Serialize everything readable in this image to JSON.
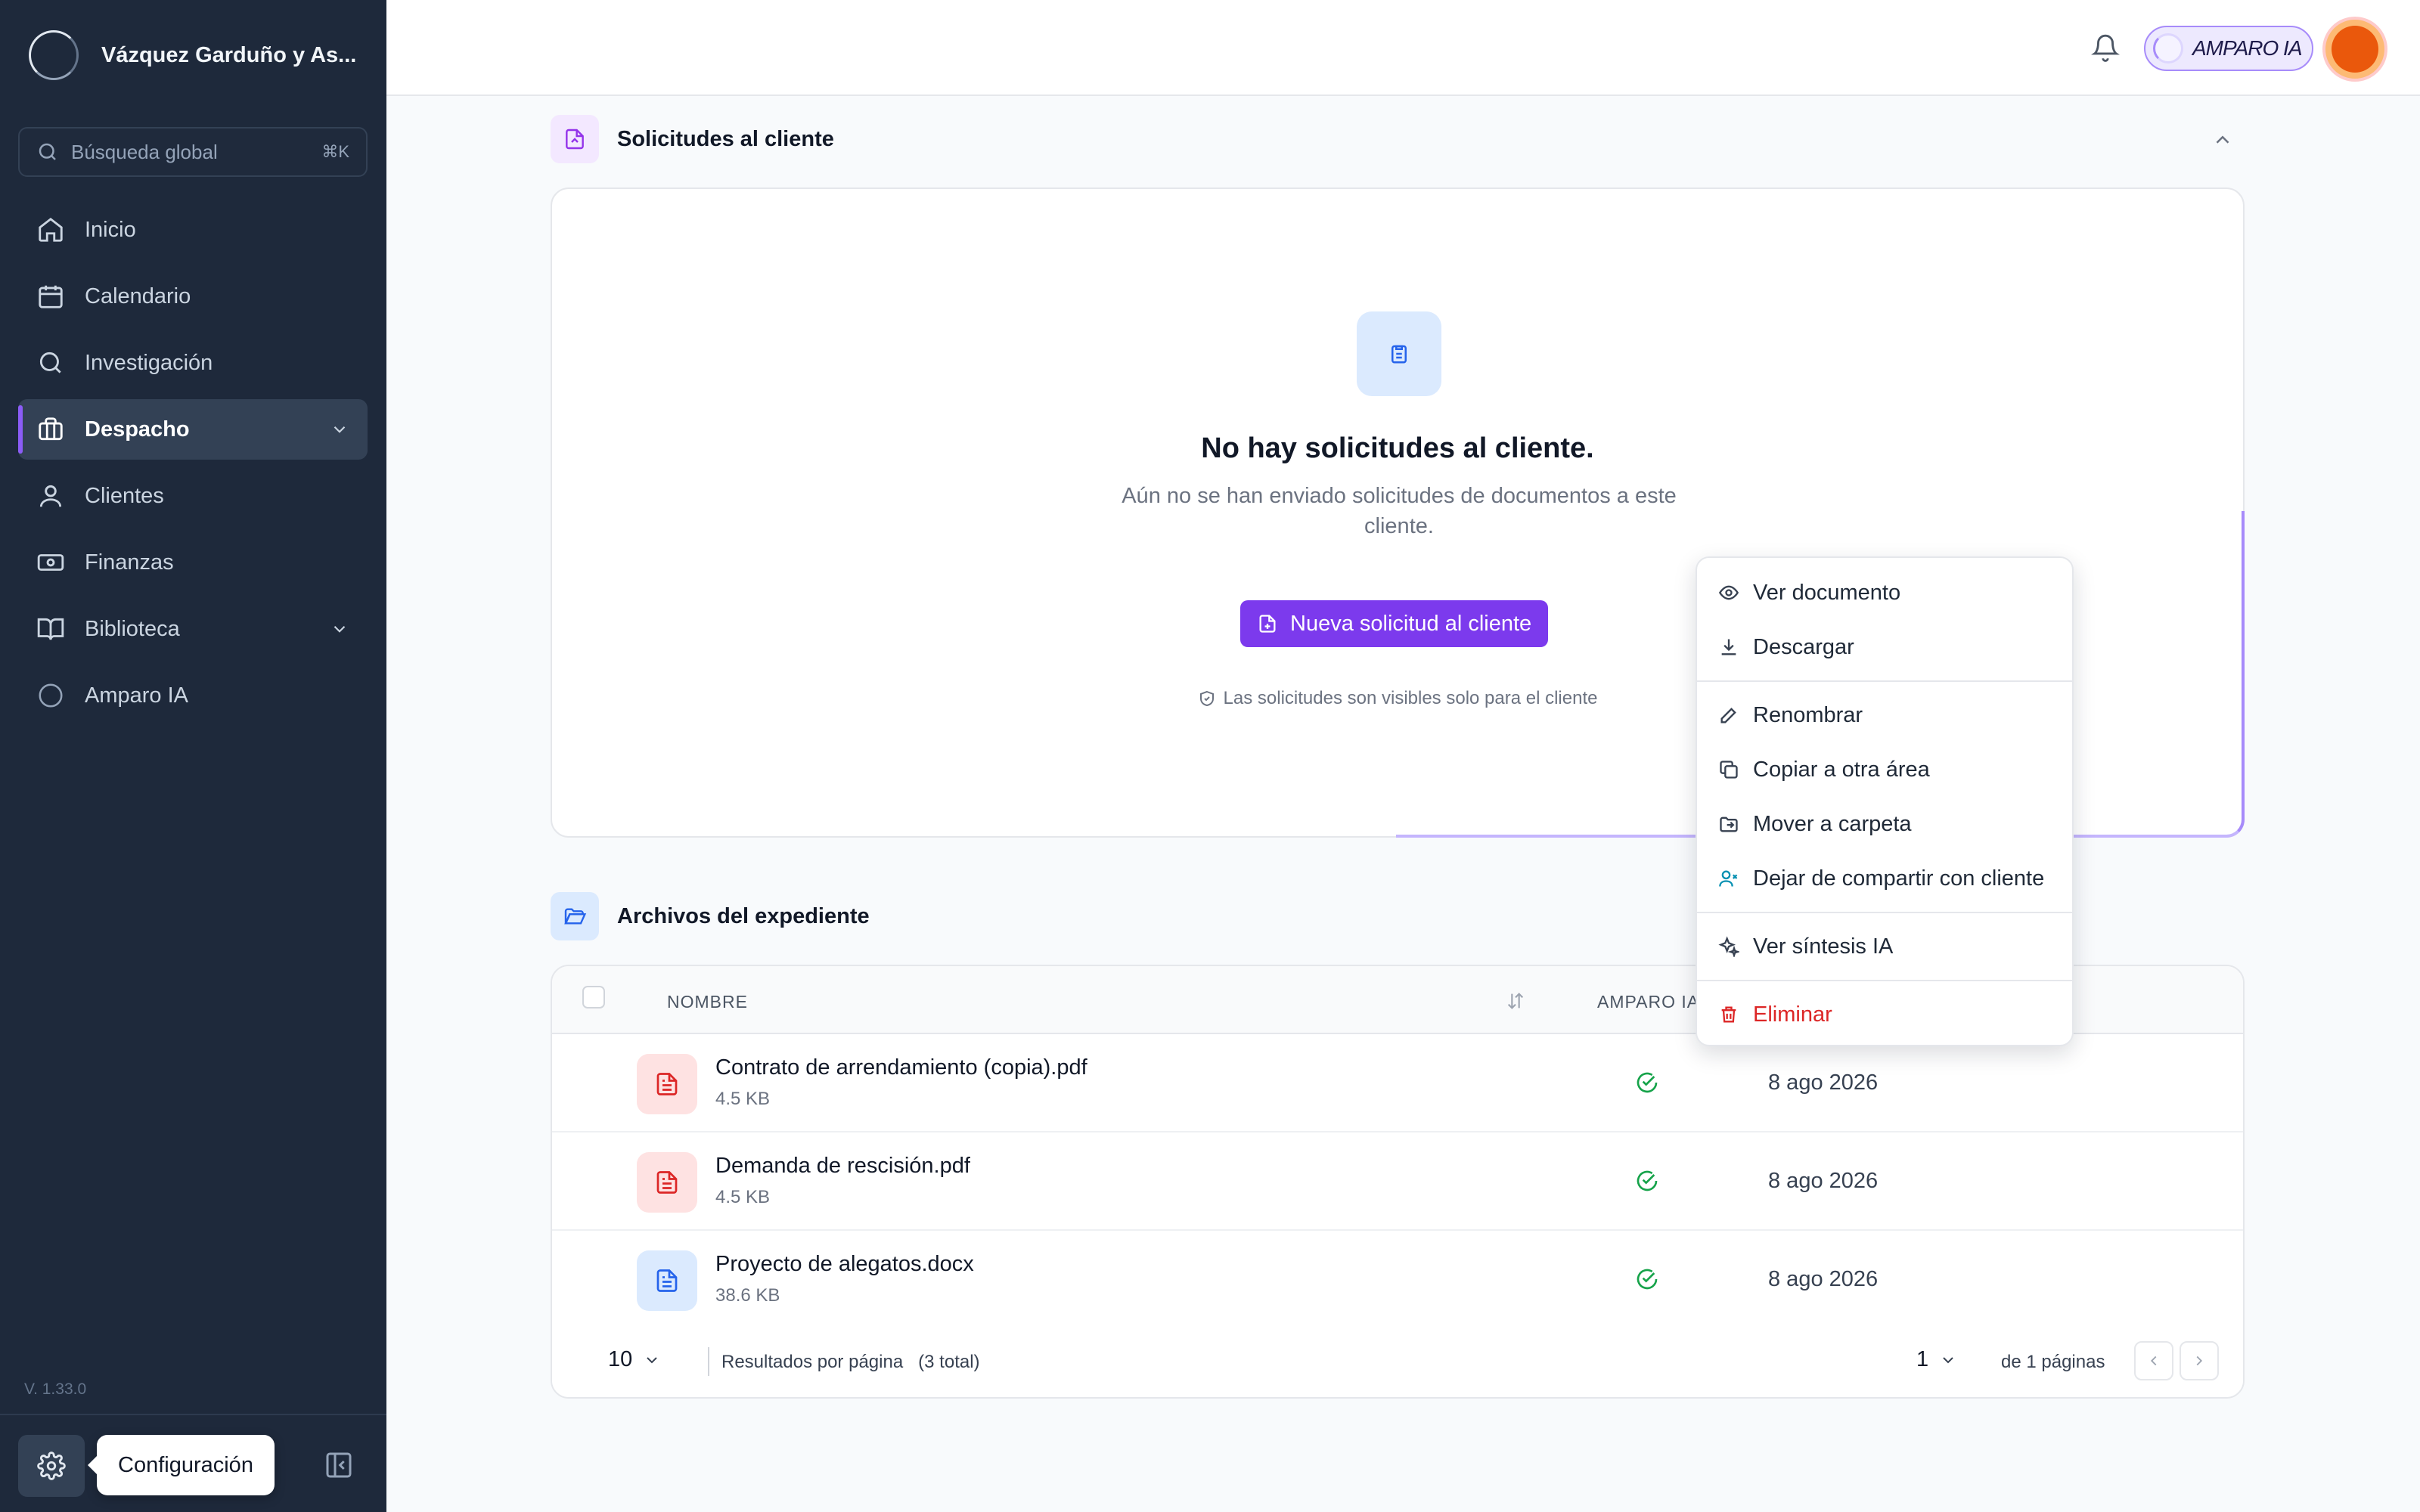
{
  "sidebar": {
    "brand": "Vázquez Garduño y As...",
    "search_placeholder": "Búsqueda global",
    "search_shortcut": "⌘K",
    "items": [
      {
        "label": "Inicio",
        "icon": "home-icon"
      },
      {
        "label": "Calendario",
        "icon": "calendar-icon"
      },
      {
        "label": "Investigación",
        "icon": "search-icon"
      },
      {
        "label": "Despacho",
        "icon": "briefcase-icon",
        "active": true
      },
      {
        "label": "Clientes",
        "icon": "user-icon"
      },
      {
        "label": "Finanzas",
        "icon": "banknote-icon"
      },
      {
        "label": "Biblioteca",
        "icon": "book-icon"
      },
      {
        "label": "Amparo IA",
        "icon": "orb-icon"
      }
    ],
    "version": "V. 1.33.0",
    "tooltip": "Configuración"
  },
  "topbar": {
    "amparo_label": "AMPARO IA"
  },
  "requests": {
    "title": "Solicitudes al cliente",
    "empty_title": "No hay solicitudes al cliente.",
    "empty_subtitle": "Aún no se han enviado solicitudes de documentos a este cliente.",
    "new_button": "Nueva solicitud al cliente",
    "note": "Las solicitudes son visibles solo para el cliente"
  },
  "files": {
    "title": "Archivos del expediente",
    "columns": {
      "name": "NOMBRE",
      "ia": "AMPARO IA"
    },
    "rows": [
      {
        "name": "Contrato de arrendamiento (copia).pdf",
        "size": "4.5 KB",
        "date": "8 ago 2026",
        "type": "pdf"
      },
      {
        "name": "Demanda de rescisión.pdf",
        "size": "4.5 KB",
        "date": "8 ago 2026",
        "type": "pdf"
      },
      {
        "name": "Proyecto de alegatos.docx",
        "size": "38.6 KB",
        "date": "8 ago 2026",
        "type": "docx"
      }
    ],
    "per_page": "10",
    "per_page_label": "Resultados por página   (3 total)",
    "page": "1",
    "page_of": "de 1 páginas"
  },
  "context_menu": {
    "view": "Ver documento",
    "download": "Descargar",
    "rename": "Renombrar",
    "copy": "Copiar a otra área",
    "move": "Mover a carpeta",
    "unshare": "Dejar de compartir con cliente",
    "summary": "Ver síntesis IA",
    "delete": "Eliminar"
  },
  "colors": {
    "sidebar_bg": "#1e293b",
    "accent": "#7c3aed",
    "danger": "#dc2626",
    "success": "#16a34a"
  }
}
